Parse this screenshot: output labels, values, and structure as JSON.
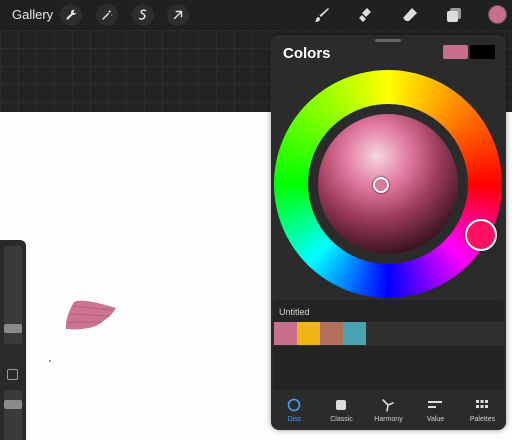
{
  "topbar": {
    "gallery_label": "Gallery",
    "left_tools": [
      "wrench-icon",
      "magic-wand-icon",
      "selection-icon",
      "transform-arrow-icon"
    ],
    "right_tools": [
      "brush-icon",
      "smudge-icon",
      "eraser-icon",
      "layers-icon"
    ],
    "active_color": "#c96e8c"
  },
  "colors_panel": {
    "title": "Colors",
    "primary_color": "#c96e8c",
    "secondary_color": "#000000",
    "selected_hue_color": "#ff1160",
    "palette": {
      "name": "Untitled",
      "swatches": [
        "#c96e8c",
        "#f0b514",
        "#b3705c",
        "#4aa3b3"
      ]
    },
    "tabs": [
      {
        "label": "Disc",
        "icon": "disc-icon",
        "active": true
      },
      {
        "label": "Classic",
        "icon": "classic-square-icon",
        "active": false
      },
      {
        "label": "Harmony",
        "icon": "harmony-icon",
        "active": false
      },
      {
        "label": "Value",
        "icon": "value-sliders-icon",
        "active": false
      },
      {
        "label": "Palettes",
        "icon": "palettes-grid-icon",
        "active": false
      }
    ]
  },
  "canvas": {
    "stroke_color": "#c96e8c"
  },
  "colors": {
    "accent": "#4a9bff",
    "panel_bg": "#2b2b2b"
  }
}
